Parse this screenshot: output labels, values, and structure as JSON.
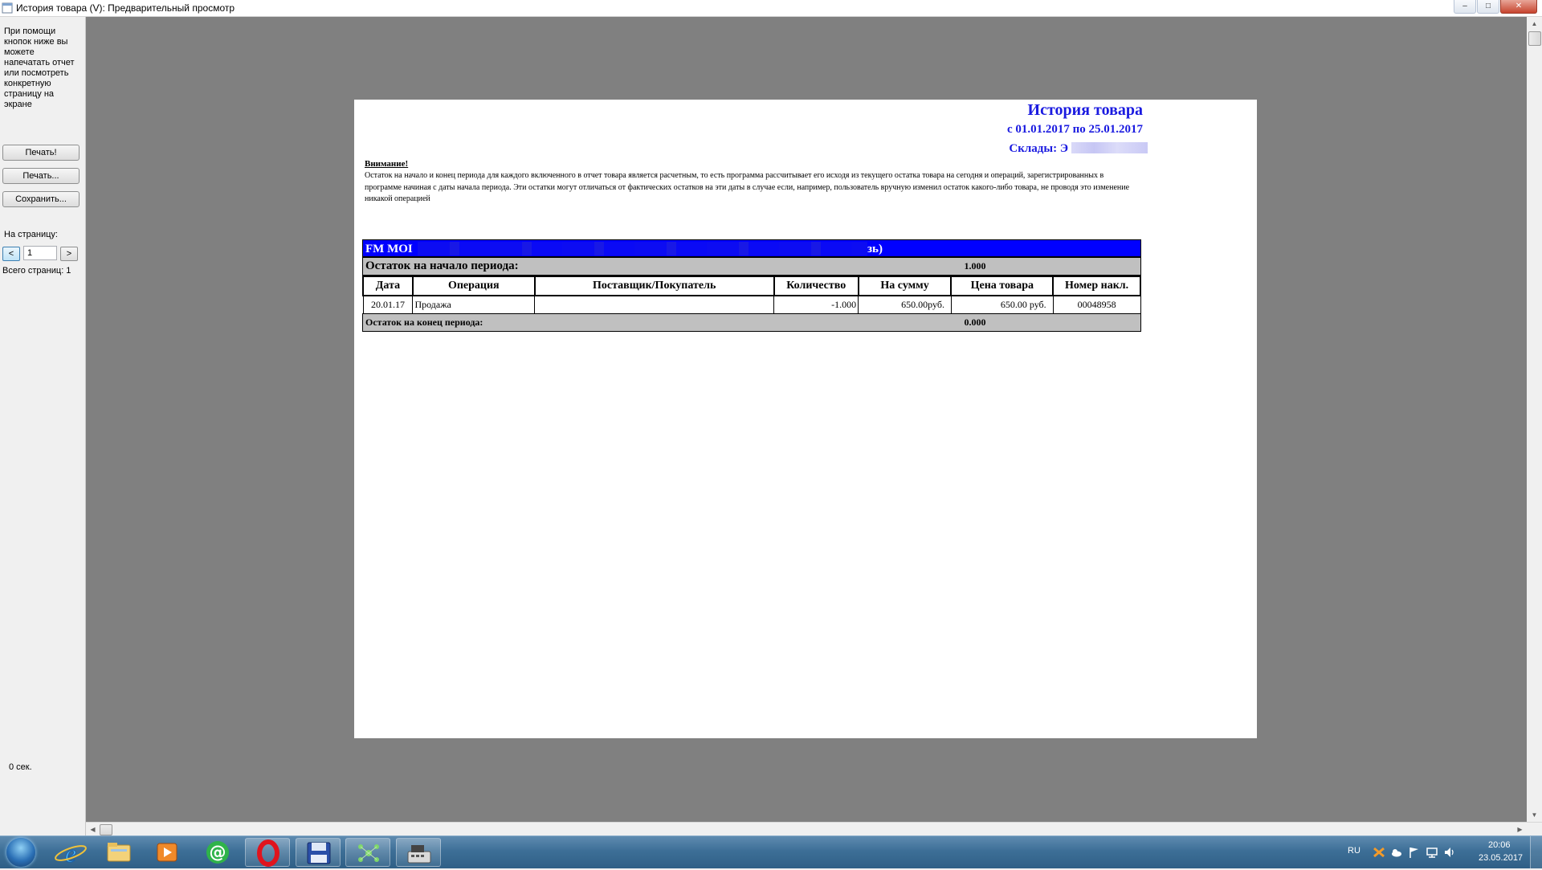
{
  "window": {
    "title": "История товара (V): Предварительный просмотр",
    "minimize_label": "–",
    "maximize_label": "□",
    "close_label": "✕"
  },
  "left_panel": {
    "help_text": "При помощи кнопок ниже вы можете напечатать отчет или посмотреть конкретную страницу на экране",
    "print_now_label": "Печать!",
    "print_dialog_label": "Печать...",
    "save_label": "Сохранить...",
    "to_page_label": "На страницу:",
    "prev_label": "<",
    "next_label": ">",
    "page_value": "1",
    "total_pages_label": "Всего страниц: 1",
    "elapsed_label": "0 сек."
  },
  "report": {
    "title": "История товара",
    "period": "с 01.01.2017 по 25.01.2017",
    "stores_label": "Склады:",
    "stores_value": "Э",
    "warning_title": "Внимание!",
    "warning_text": "Остаток на начало и конец периода для каждого включенного в отчет товара является расчетным, то есть программа рассчитывает его исходя из текущего остатка товара на сегодня и операций, зарегистрированных в программе начиная с даты начала периода. Эти остатки могут отличаться от фактических остатков на эти даты в случае если, например, пользователь вручную изменил остаток какого-либо товара, не проводя это изменение никакой операцией",
    "product_prefix": "FM MOI",
    "product_suffix": "зь)",
    "opening_label": "Остаток на начало периода:",
    "opening_value": "1.000",
    "columns": [
      "Дата",
      "Операция",
      "Поставщик/Покупатель",
      "Количество",
      "На сумму",
      "Цена товара",
      "Номер накл."
    ],
    "rows": [
      {
        "date": "20.01.17",
        "operation": "Продажа",
        "party": "",
        "quantity": "-1.000",
        "sum": "650.00руб.",
        "price": "650.00  руб.",
        "invoice": "00048958"
      }
    ],
    "closing_label": "Остаток на конец периода:",
    "closing_value": "0.000"
  },
  "taskbar": {
    "pinned": [
      "windows-start",
      "internet-explorer",
      "file-explorer",
      "media-player",
      "mail-agent",
      "opera",
      "save-app",
      "network-app",
      "cash-register-app"
    ],
    "language": "RU",
    "time": "20:06",
    "date": "23.05.2017"
  }
}
